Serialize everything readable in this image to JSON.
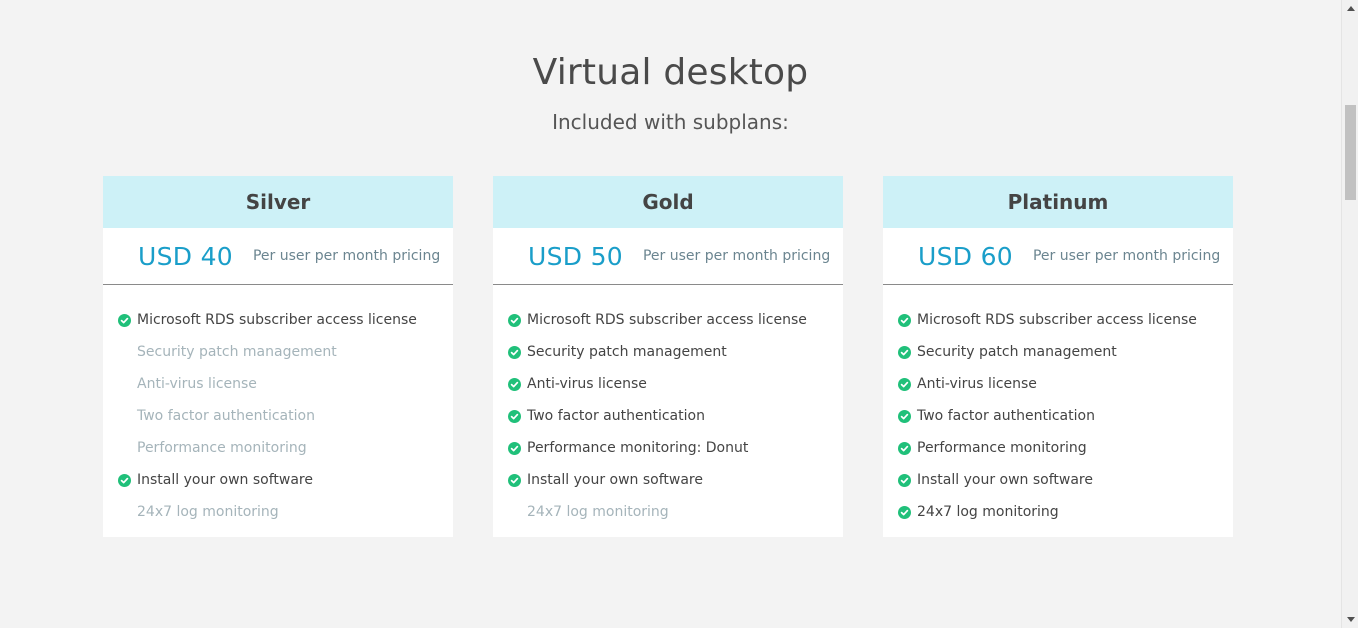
{
  "section": {
    "title": "Virtual desktop",
    "subtitle": "Included with subplans:"
  },
  "plans": [
    {
      "name": "Silver",
      "price": "USD 40",
      "price_note": "Per user per month pricing",
      "features": [
        {
          "label": "Microsoft RDS subscriber access license",
          "included": true
        },
        {
          "label": "Security patch management",
          "included": false
        },
        {
          "label": "Anti-virus license",
          "included": false
        },
        {
          "label": "Two factor authentication",
          "included": false
        },
        {
          "label": "Performance monitoring",
          "included": false
        },
        {
          "label": "Install your own software",
          "included": true
        },
        {
          "label": "24x7 log monitoring",
          "included": false
        }
      ]
    },
    {
      "name": "Gold",
      "price": "USD 50",
      "price_note": "Per user per month pricing",
      "features": [
        {
          "label": "Microsoft RDS subscriber access license",
          "included": true
        },
        {
          "label": "Security patch management",
          "included": true
        },
        {
          "label": "Anti-virus license",
          "included": true
        },
        {
          "label": "Two factor authentication",
          "included": true
        },
        {
          "label": "Performance monitoring: Donut",
          "included": true
        },
        {
          "label": "Install your own software",
          "included": true
        },
        {
          "label": "24x7 log monitoring",
          "included": false
        }
      ]
    },
    {
      "name": "Platinum",
      "price": "USD 60",
      "price_note": "Per user per month pricing",
      "features": [
        {
          "label": "Microsoft RDS subscriber access license",
          "included": true
        },
        {
          "label": "Security patch management",
          "included": true
        },
        {
          "label": "Anti-virus license",
          "included": true
        },
        {
          "label": "Two factor authentication",
          "included": true
        },
        {
          "label": "Performance monitoring",
          "included": true
        },
        {
          "label": "Install your own software",
          "included": true
        },
        {
          "label": "24x7 log monitoring",
          "included": true
        }
      ]
    }
  ],
  "colors": {
    "page_background": "#f3f3f3",
    "header_background": "#cdf1f7",
    "price_text": "#1a9ec9",
    "check_icon": "#20c07a",
    "included_text": "#444444",
    "excluded_text": "#a5b4ba"
  },
  "icons": {
    "included": "check-circle-icon",
    "scroll_up": "chevron-up-icon",
    "scroll_down": "chevron-down-icon"
  }
}
